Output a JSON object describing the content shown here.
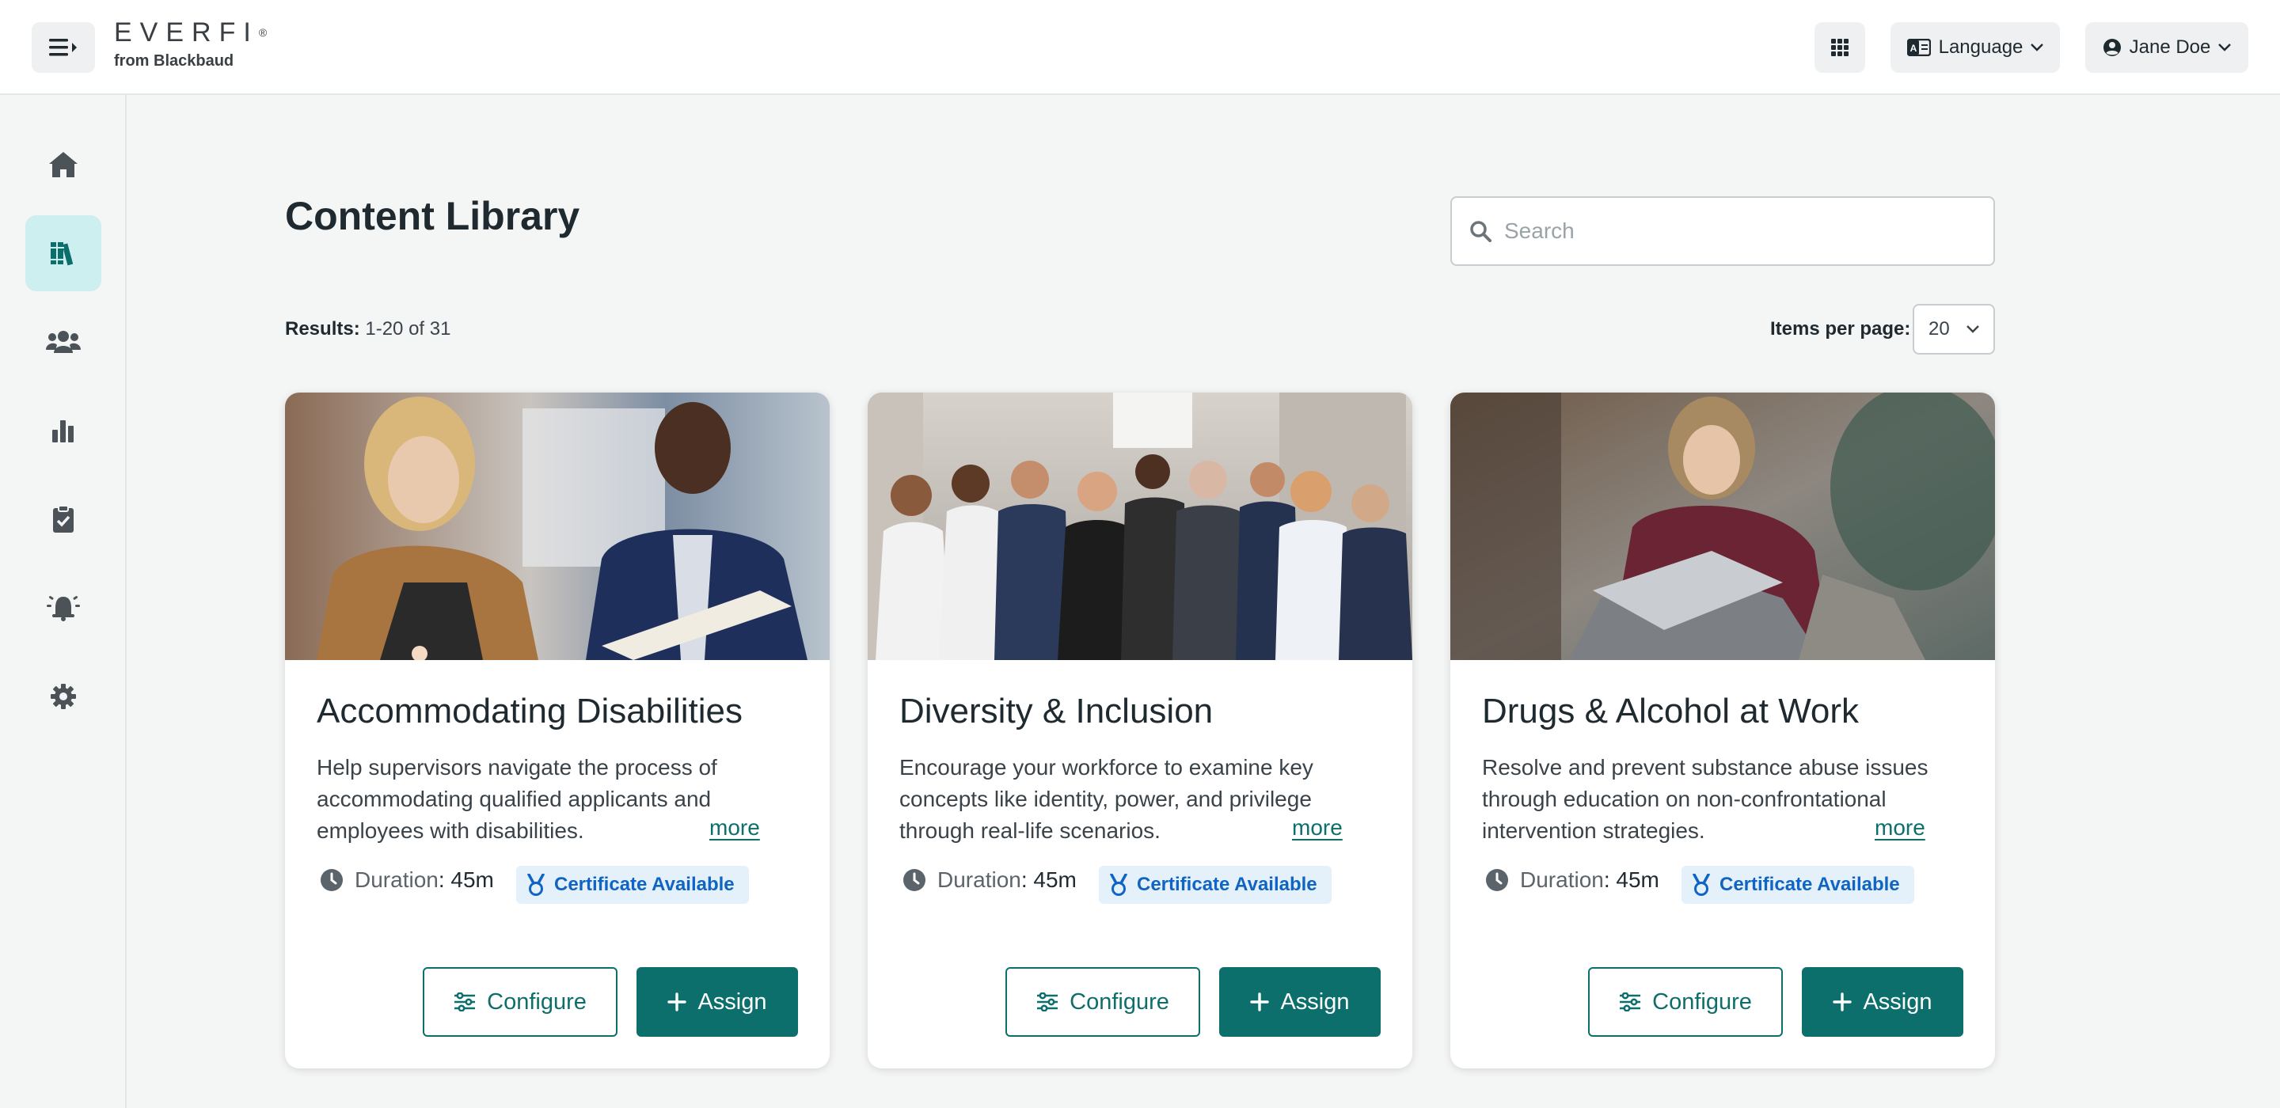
{
  "header": {
    "logo_text": "EVERFI",
    "logo_sub": "from Blackbaud",
    "language_label": "Language",
    "user_name": "Jane Doe"
  },
  "sidebar": {
    "items": [
      {
        "name": "home",
        "icon": "home-icon",
        "active": false
      },
      {
        "name": "library",
        "icon": "library-icon",
        "active": true
      },
      {
        "name": "users",
        "icon": "users-icon",
        "active": false
      },
      {
        "name": "reports",
        "icon": "bar-chart-icon",
        "active": false
      },
      {
        "name": "assignments",
        "icon": "clipboard-check-icon",
        "active": false
      },
      {
        "name": "notifications",
        "icon": "alarm-bell-icon",
        "active": false
      },
      {
        "name": "settings",
        "icon": "gear-icon",
        "active": false
      }
    ]
  },
  "main": {
    "title": "Content Library",
    "search_placeholder": "Search",
    "results_label": "Results:",
    "results_value": "1-20 of 31",
    "items_per_page_label": "Items per page:",
    "items_per_page_value": "20"
  },
  "cards": [
    {
      "title": "Accommodating Disabilities",
      "description": "Help supervisors navigate the process of accommodating qualified applicants and employees with disabilities.",
      "more": "more",
      "duration_label": "Duration",
      "duration_value": ": 45m",
      "certificate": "Certificate Available",
      "configure": "Configure",
      "assign": "Assign"
    },
    {
      "title": "Diversity & Inclusion",
      "description": "Encourage your workforce to examine key concepts like identity, power, and privilege through real-life scenarios.",
      "more": "more",
      "duration_label": "Duration",
      "duration_value": ": 45m",
      "certificate": "Certificate Available",
      "configure": "Configure",
      "assign": "Assign"
    },
    {
      "title": "Drugs & Alcohol at Work",
      "description": "Resolve and prevent substance abuse issues through education on non-confrontational intervention strategies.",
      "more": "more",
      "duration_label": "Duration",
      "duration_value": ": 45m",
      "certificate": "Certificate Available",
      "configure": "Configure",
      "assign": "Assign"
    }
  ],
  "colors": {
    "accent": "#0d6f6c",
    "active_nav_bg": "#cdeff0",
    "badge_bg": "#e4f0fa",
    "badge_text": "#1064c3"
  }
}
